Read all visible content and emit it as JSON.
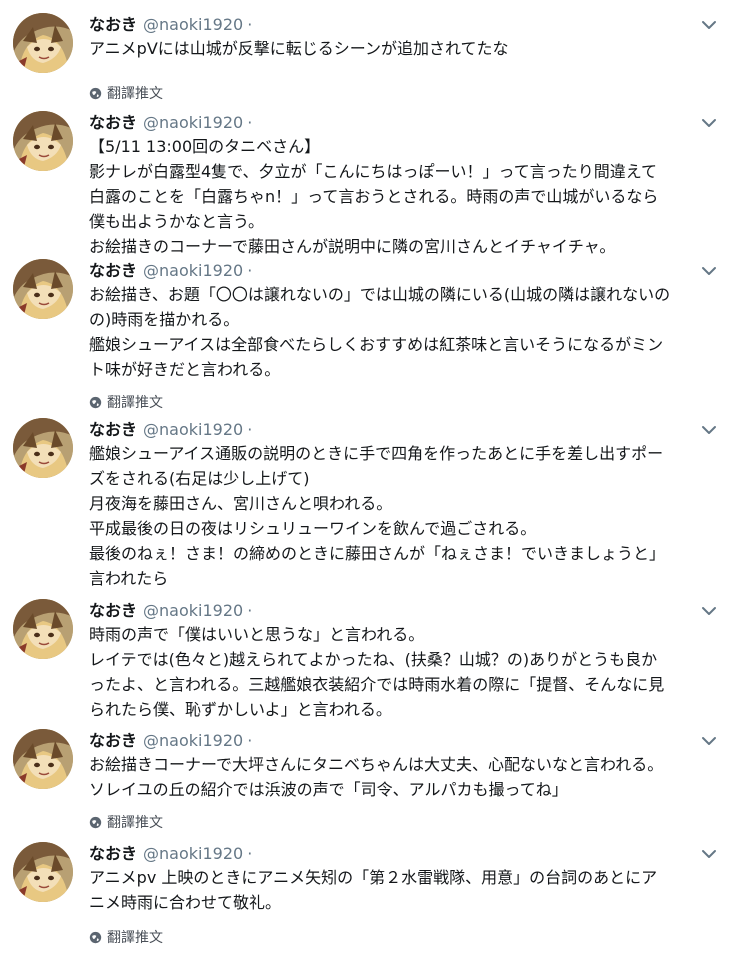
{
  "colors": {
    "name": "#14171a",
    "handle": "#657786",
    "text": "#14171a",
    "translate": "#4a5058",
    "background": "#ffffff"
  },
  "icons": {
    "caret": "chevron-down-icon",
    "translate": "globe-icon"
  },
  "tweets": [
    {
      "name": "なおき",
      "handle": "@naoki1920",
      "separator": "·",
      "lines": [
        "アニメpVには山城が反撃に転じるシーンが追加されてたな"
      ],
      "translate": "翻譯推文"
    },
    {
      "name": "なおき",
      "handle": "@naoki1920",
      "separator": "·",
      "lines": [
        "【5/11 13:00回のタニベさん】",
        "影ナレが白露型4隻で、夕立が「こんにちはっぽーい！」って言ったり間違えて",
        "白露のことを「白露ちゃn！」って言おうとされる。時雨の声で山城がいるなら",
        "僕も出ようかなと言う。",
        "お絵描きのコーナーで藤田さんが説明中に隣の宮川さんとイチャイチャ。"
      ]
    },
    {
      "name": "なおき",
      "handle": "@naoki1920",
      "separator": "·",
      "lines": [
        "お絵描き、お題「〇〇は譲れないの」では山城の隣にいる(山城の隣は譲れないの",
        "の)時雨を描かれる。",
        "艦娘シューアイスは全部食べたらしくおすすめは紅茶味と言いそうになるがミン",
        "ト味が好きだと言われる。"
      ],
      "translate": "翻譯推文"
    },
    {
      "name": "なおき",
      "handle": "@naoki1920",
      "separator": "·",
      "lines": [
        "艦娘シューアイス通販の説明のときに手で四角を作ったあとに手を差し出すポー",
        "ズをされる(右足は少し上げて)",
        "月夜海を藤田さん、宮川さんと唄われる。",
        "平成最後の日の夜はリシュリューワインを飲んで過ごされる。",
        "最後のねぇ！さま！の締めのときに藤田さんが「ねぇさま！でいきましょうと」",
        "言われたら"
      ]
    },
    {
      "name": "なおき",
      "handle": "@naoki1920",
      "separator": "·",
      "lines": [
        "時雨の声で「僕はいいと思うな」と言われる。",
        "レイテでは(色々と)越えられてよかったね、(扶桑？山城？の)ありがとうも良か",
        "ったよ、と言われる。三越艦娘衣装紹介では時雨水着の際に「提督、そんなに見",
        "られたら僕、恥ずかしいよ」と言われる。"
      ]
    },
    {
      "name": "なおき",
      "handle": "@naoki1920",
      "separator": "·",
      "lines": [
        "お絵描きコーナーで大坪さんにタニベちゃんは大丈夫、心配ないなと言われる。",
        "ソレイユの丘の紹介では浜波の声で「司令、アルパカも撮ってね」"
      ],
      "translate": "翻譯推文"
    },
    {
      "name": "なおき",
      "handle": "@naoki1920",
      "separator": "·",
      "lines": [
        "アニメpv 上映のときにアニメ矢矧の「第２水雷戦隊、用意」の台詞のあとにア",
        "ニメ時雨に合わせて敬礼。"
      ],
      "translate": "翻譯推文"
    }
  ]
}
